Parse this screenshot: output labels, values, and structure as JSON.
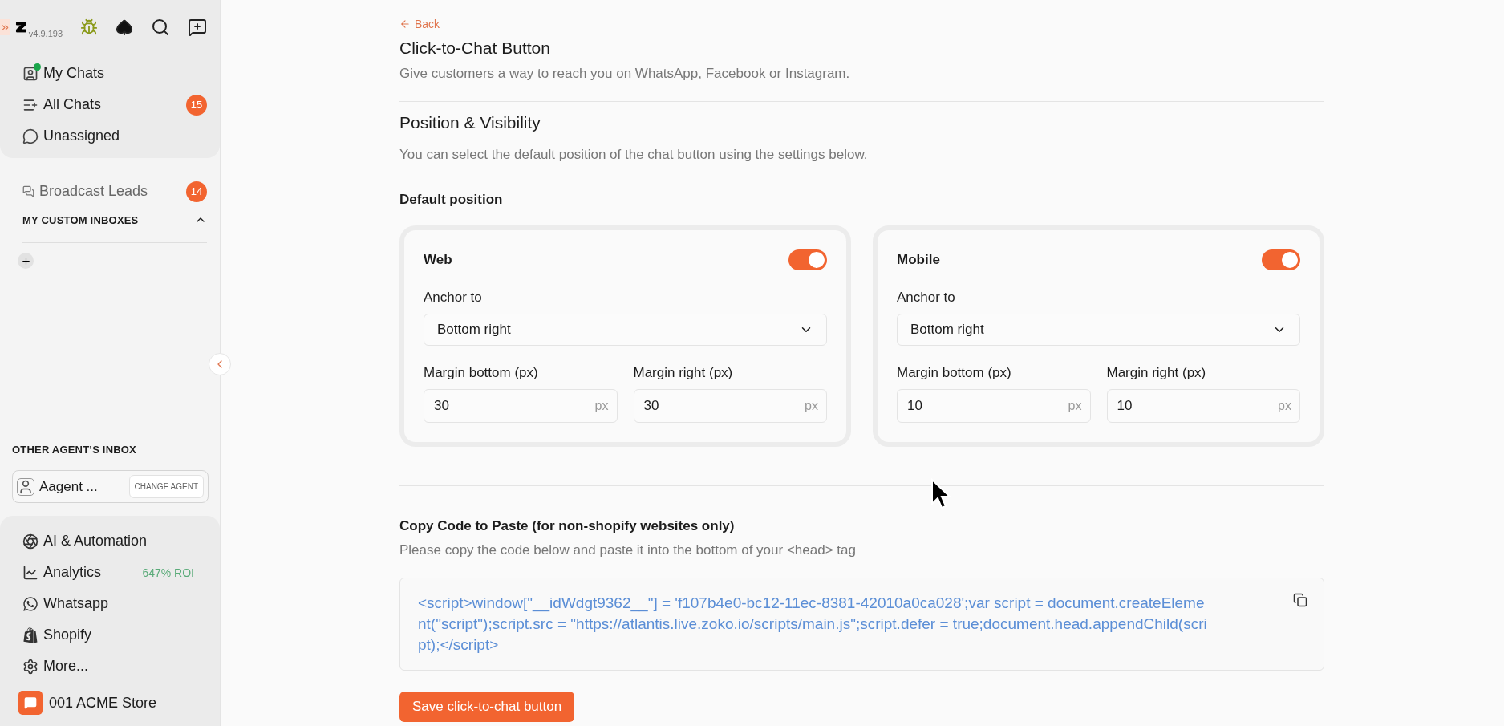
{
  "sidebar": {
    "version": "v4.9.193",
    "primary_nav": [
      {
        "label": "My Chats",
        "online": true
      },
      {
        "label": "All Chats",
        "badge": "15"
      },
      {
        "label": "Unassigned"
      }
    ],
    "broadcast": {
      "label": "Broadcast Leads",
      "badge": "14"
    },
    "custom_inboxes": {
      "heading": "MY CUSTOM INBOXES",
      "expanded": true
    },
    "other_agent": {
      "heading": "OTHER AGENT’S INBOX",
      "agent": "Aagent ...",
      "button": "CHANGE AGENT"
    },
    "bottom_nav": [
      {
        "label": "AI & Automation"
      },
      {
        "label": "Analytics",
        "tag": "647% ROI"
      },
      {
        "label": "Whatsapp"
      },
      {
        "label": "Shopify"
      },
      {
        "label": "More..."
      }
    ],
    "store": "001 ACME Store"
  },
  "page": {
    "back": "Back",
    "title": "Click-to-Chat Button",
    "subtitle": "Give customers a way to reach you on WhatsApp, Facebook or Instagram.",
    "section": {
      "title": "Position & Visibility",
      "description": "You can select the default position of the chat button using the settings below.",
      "label": "Default position"
    },
    "cards": [
      {
        "title": "Web",
        "on": true,
        "anchor_label": "Anchor to",
        "anchor": "Bottom right",
        "fields": [
          {
            "label": "Margin bottom (px)",
            "value": "30",
            "unit": "px"
          },
          {
            "label": "Margin right (px)",
            "value": "30",
            "unit": "px"
          }
        ]
      },
      {
        "title": "Mobile",
        "on": true,
        "anchor_label": "Anchor to",
        "anchor": "Bottom right",
        "fields": [
          {
            "label": "Margin bottom (px)",
            "value": "10",
            "unit": "px"
          },
          {
            "label": "Margin right (px)",
            "value": "10",
            "unit": "px"
          }
        ]
      }
    ],
    "code": {
      "title": "Copy Code to Paste (for non-shopify websites only)",
      "description": "Please copy the code below and paste it into the bottom of your <head> tag",
      "snippet": "<script>window[\"__idWdgt9362__\"] = 'f107b4e0-bc12-11ec-8381-42010a0ca028';var script = document.createElement(\"script\");script.src = \"https://atlantis.live.zoko.io/scripts/main.js\";script.defer = true;document.head.appendChild(script);</script>"
    },
    "save": "Save click-to-chat button"
  }
}
